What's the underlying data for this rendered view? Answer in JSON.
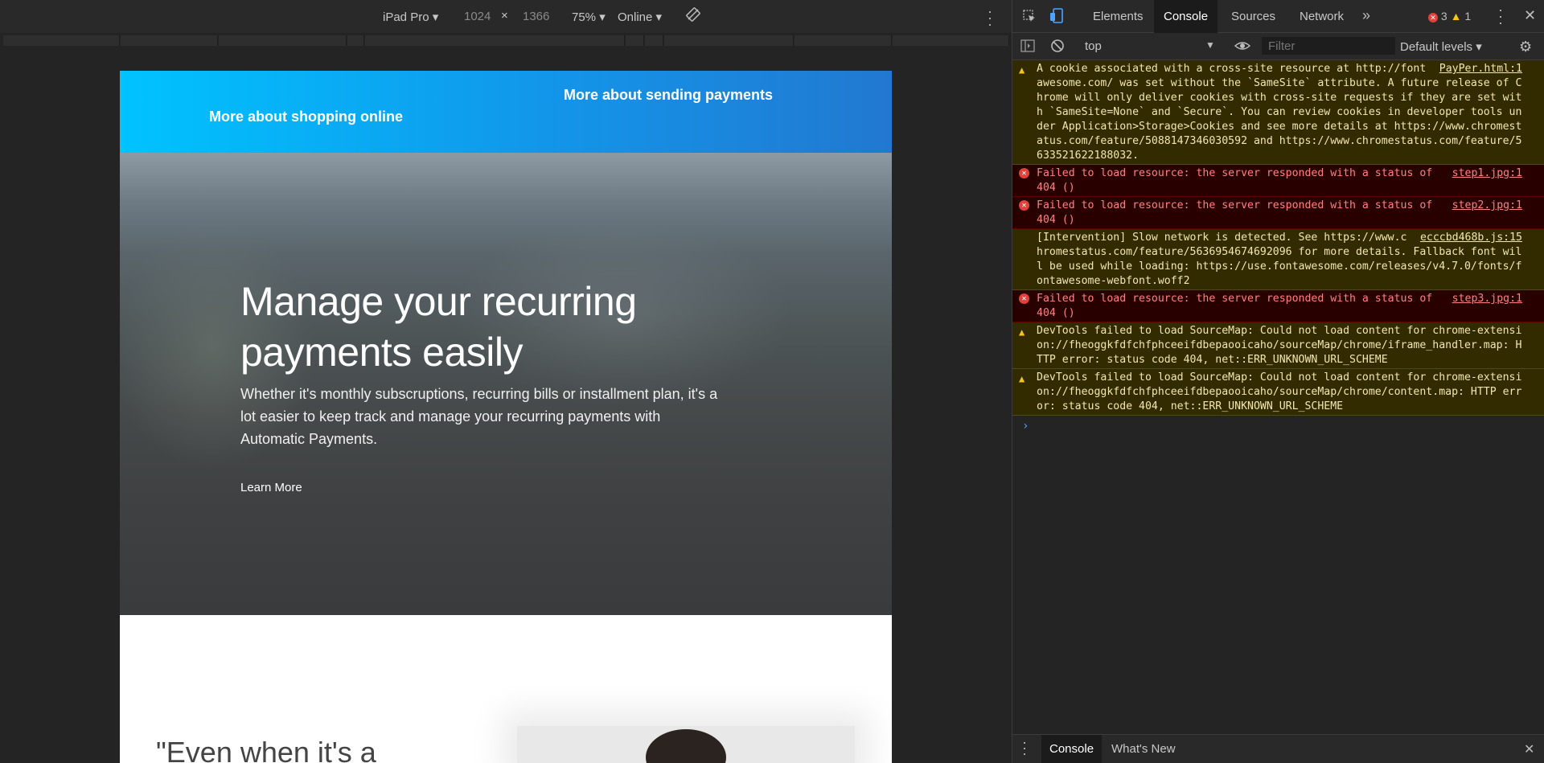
{
  "device_toolbar": {
    "device": "iPad Pro",
    "width": "1024",
    "x_sep": "×",
    "height": "1366",
    "zoom": "75%",
    "throttle": "Online",
    "rotate_icon": "rotate-icon",
    "menu_icon": "vertical-dots-icon"
  },
  "page": {
    "nav_shopping": "More about shopping online",
    "nav_payments": "More about sending payments",
    "hero_title": "Manage your recurring payments easily",
    "hero_text": "Whether it's monthly subscruptions, recurring bills or installment plan, it's a lot easier to keep track and manage your recurring payments with Automatic Payments.",
    "learn_more": "Learn More",
    "quote_partial": "\"Even when it's a"
  },
  "devtools": {
    "tabs": [
      "Elements",
      "Console",
      "Sources",
      "Network"
    ],
    "active_tab": "Console",
    "more_tabs": "»",
    "error_count": "3",
    "warning_count": "1",
    "context": "top",
    "filter_placeholder": "Filter",
    "levels": "Default levels",
    "drawer_tabs": [
      "Console",
      "What's New"
    ],
    "colors": {
      "error_bg": "#290000",
      "warning_bg": "#332b00",
      "active_tab": "#1b1b1b"
    }
  },
  "console": {
    "messages": [
      {
        "level": "warning",
        "source": "PayPer.html:1",
        "text": "A cookie associated with a cross-site resource at http://fontawesome.com/ was set without the `SameSite` attribute. A future release of Chrome will only deliver cookies with cross-site requests if they are set with `SameSite=None` and `Secure`. You can review cookies in developer tools under Application>Storage>Cookies and see more details at https://www.chromestatus.com/feature/5088147346030592 and https://www.chromestatus.com/feature/5633521622188032."
      },
      {
        "level": "error",
        "source": "step1.jpg:1",
        "text": "Failed to load resource: the server responded with a status of 404 ()"
      },
      {
        "level": "error",
        "source": "step2.jpg:1",
        "text": "Failed to load resource: the server responded with a status of 404 ()"
      },
      {
        "level": "info",
        "source": "ecccbd468b.js:15",
        "text": "[Intervention] Slow network is detected. See https://www.chromestatus.com/feature/5636954674692096 for more details. Fallback font will be used while loading: https://use.fontawesome.com/releases/v4.7.0/fonts/fontawesome-webfont.woff2"
      },
      {
        "level": "error",
        "source": "step3.jpg:1",
        "text": "Failed to load resource: the server responded with a status of 404 ()"
      },
      {
        "level": "warning",
        "source": "",
        "text": "DevTools failed to load SourceMap: Could not load content for chrome-extension://fheoggkfdfchfphceeifdbepaooicaho/sourceMap/chrome/iframe_handler.map: HTTP error: status code 404, net::ERR_UNKNOWN_URL_SCHEME"
      },
      {
        "level": "warning",
        "source": "",
        "text": "DevTools failed to load SourceMap: Could not load content for chrome-extension://fheoggkfdfchfphceeifdbepaooicaho/sourceMap/chrome/content.map: HTTP error: status code 404, net::ERR_UNKNOWN_URL_SCHEME"
      }
    ],
    "prompt": "›"
  }
}
